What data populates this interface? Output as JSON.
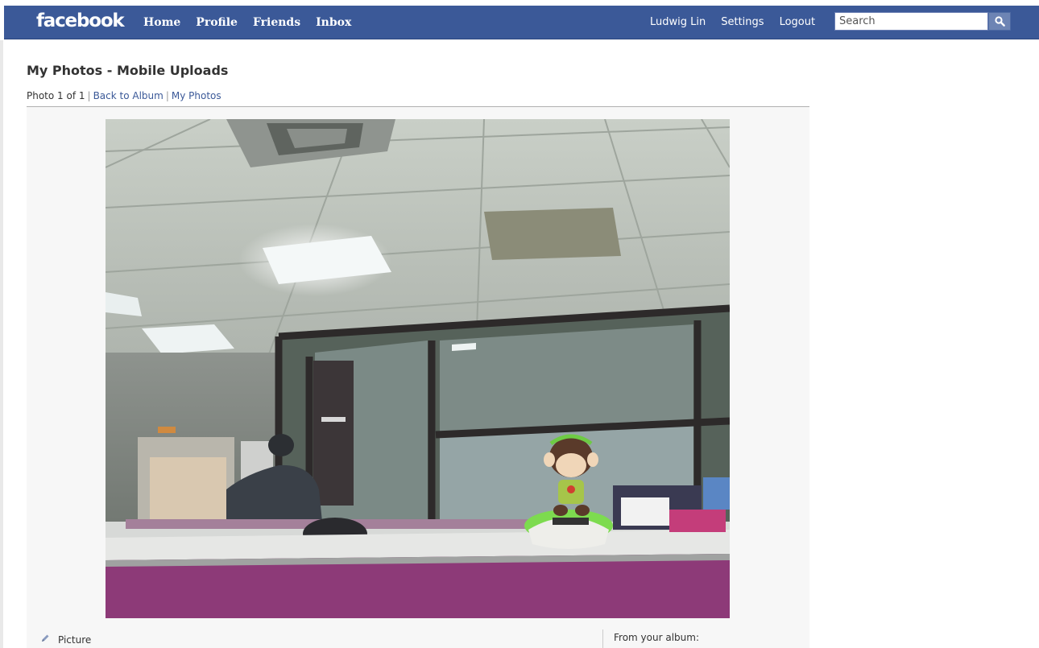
{
  "topbar": {
    "logo": "facebook",
    "nav_left": [
      "Home",
      "Profile",
      "Friends",
      "Inbox"
    ],
    "user_name": "Ludwig Lin",
    "settings": "Settings",
    "logout": "Logout",
    "search_placeholder": "Search",
    "brand_color": "#3b5998"
  },
  "page": {
    "title": "My Photos - Mobile Uploads",
    "photo_count": "Photo 1 of 1",
    "back_to_album": "Back to Album",
    "my_photos": "My Photos"
  },
  "photo": {
    "caption": "Picture",
    "from_album_label": "From your album:"
  },
  "icons": {
    "search": "search-icon",
    "edit": "pencil-icon"
  }
}
